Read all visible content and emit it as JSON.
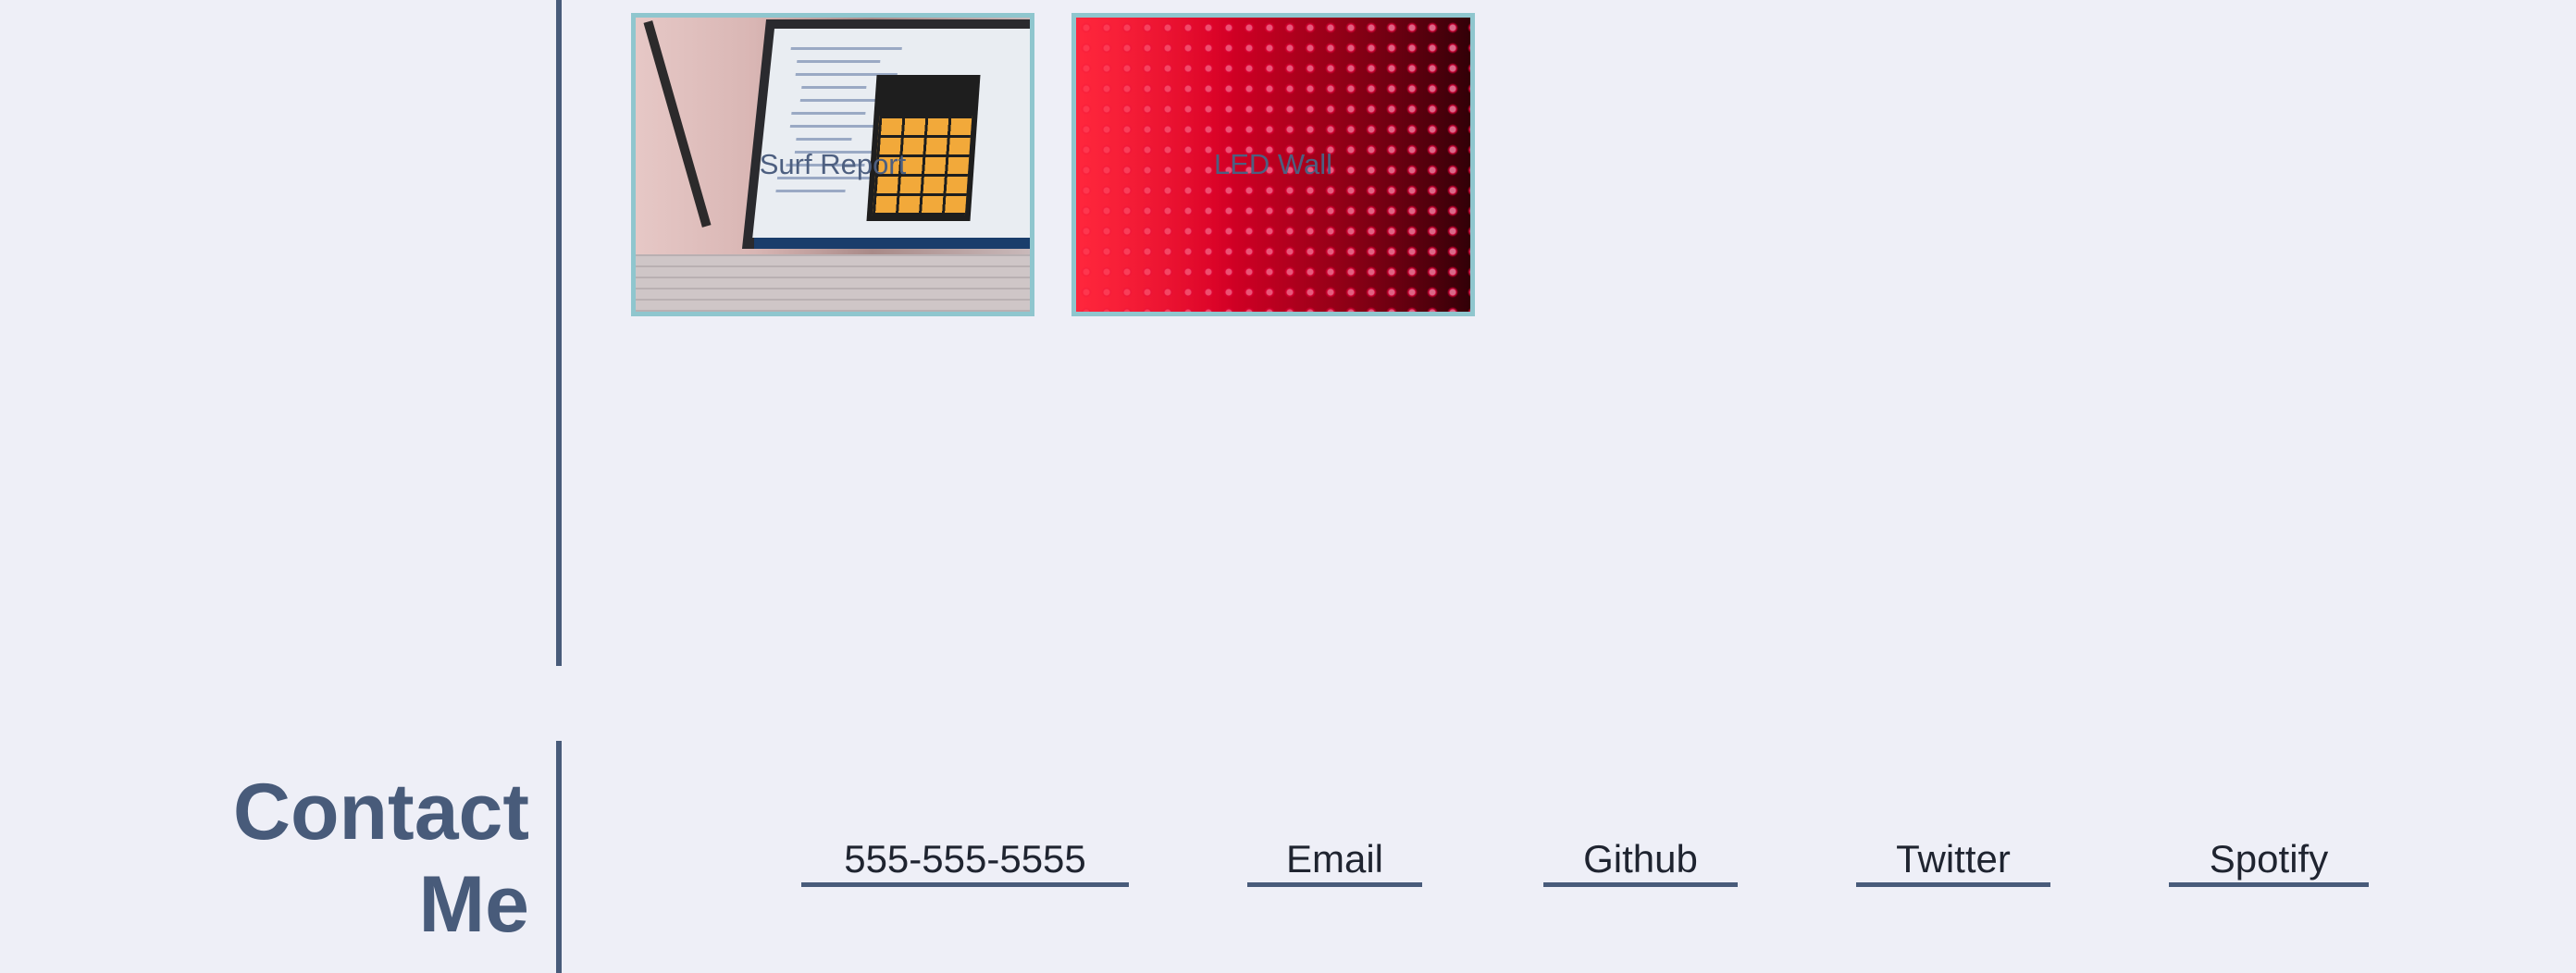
{
  "projects": [
    {
      "label": "Surf Report",
      "image": "laptop-calculator-photo"
    },
    {
      "label": "LED Wall",
      "image": "red-led-wall-photo"
    }
  ],
  "contact": {
    "title_line1": "Contact",
    "title_line2": "Me",
    "links": [
      {
        "label": "555-555-5555"
      },
      {
        "label": "Email"
      },
      {
        "label": "Github"
      },
      {
        "label": "Twitter"
      },
      {
        "label": "Spotify"
      }
    ]
  },
  "colors": {
    "background": "#eeeff7",
    "accent": "#485b7a",
    "card_border": "#8fc6ce"
  }
}
